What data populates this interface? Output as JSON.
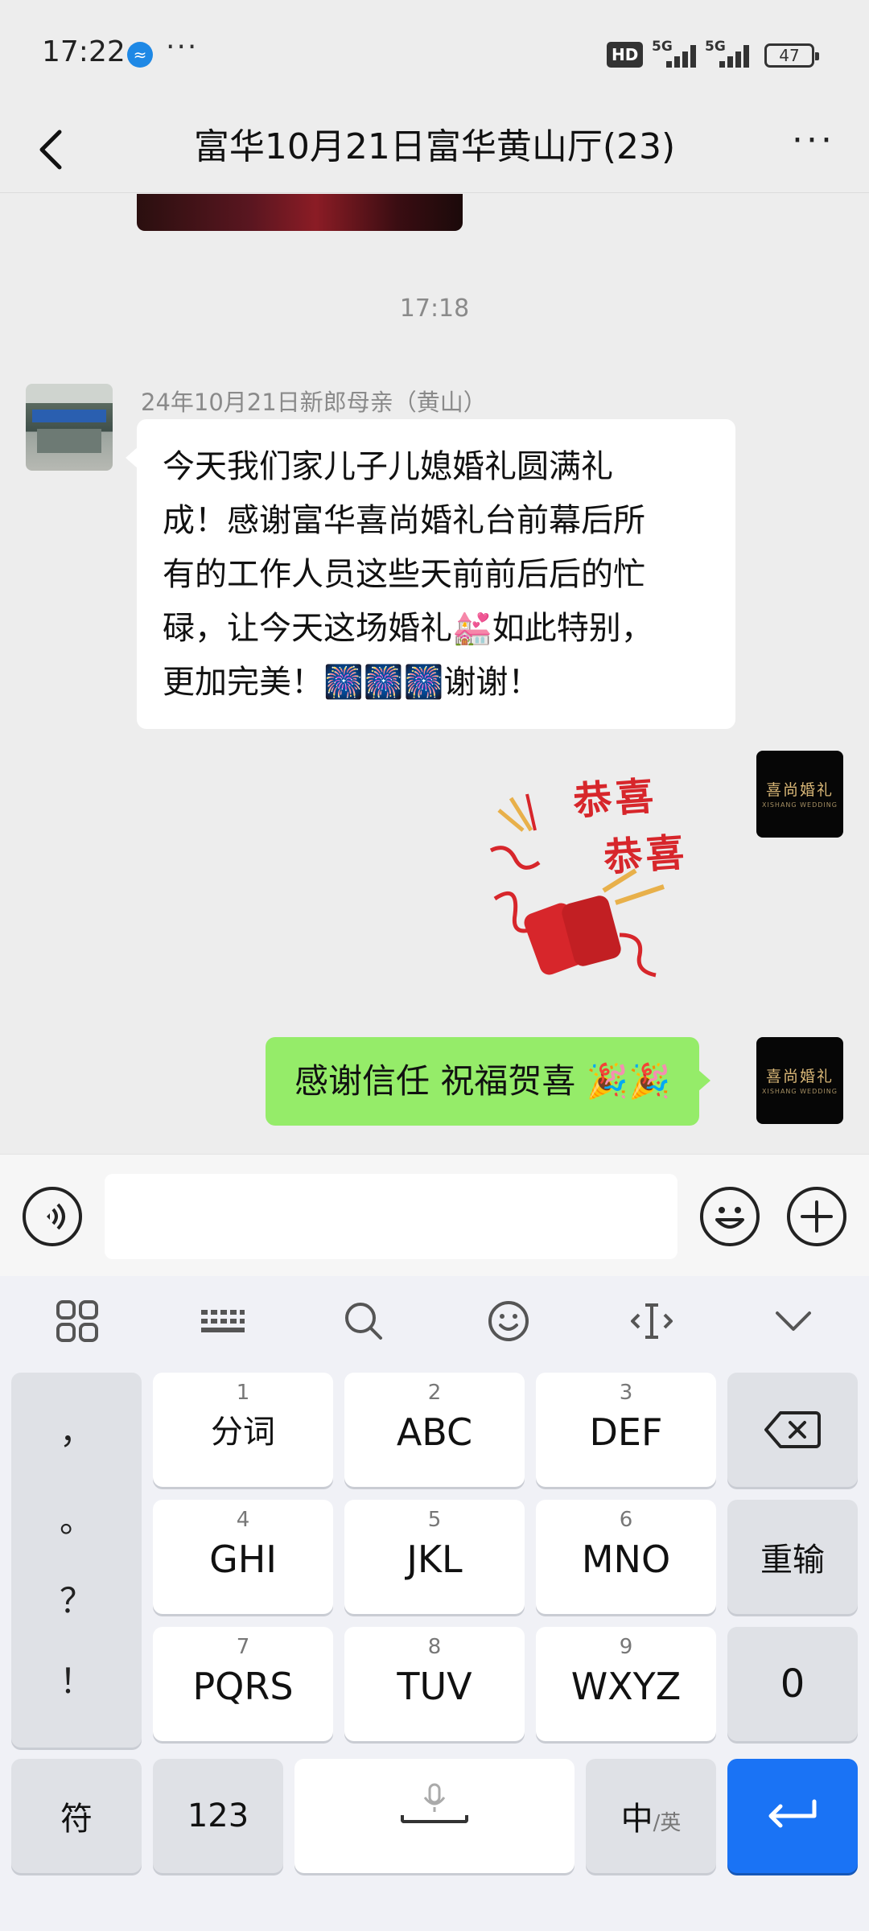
{
  "status_bar": {
    "time": "17:22",
    "network1": "5G",
    "network2": "5G",
    "hd": "HD",
    "battery": "47",
    "app_notification_icon": "messenger-icon"
  },
  "header": {
    "title": "富华10月21日富华黄山厅(23)"
  },
  "chat": {
    "timestamp": "17:18",
    "message1": {
      "sender": "24年10月21日新郎母亲（黄山）",
      "lines": [
        "今天我们家儿子儿媳婚礼圆满礼",
        "成！感谢富华喜尚婚礼台前幕后所",
        "有的工作人员这些天前前后后的忙",
        "碌，让今天这场婚礼💒如此特别，",
        "更加完美！🎆🎆🎆谢谢！"
      ]
    },
    "sticker": {
      "line1": "恭喜",
      "line2": "恭喜"
    },
    "message2": {
      "text": "感谢信任 祝福贺喜 🎉🎉"
    },
    "my_avatar": {
      "brand": "喜尚婚礼",
      "brand_en": "XISHANG WEDDING"
    }
  },
  "input_bar": {
    "placeholder": ""
  },
  "keyboard": {
    "punct": [
      "，",
      "。",
      "？",
      "！"
    ],
    "keys": [
      {
        "num": "1",
        "label": "分词"
      },
      {
        "num": "2",
        "label": "ABC"
      },
      {
        "num": "3",
        "label": "DEF"
      },
      {
        "num": "4",
        "label": "GHI"
      },
      {
        "num": "5",
        "label": "JKL"
      },
      {
        "num": "6",
        "label": "MNO"
      },
      {
        "num": "7",
        "label": "PQRS"
      },
      {
        "num": "8",
        "label": "TUV"
      },
      {
        "num": "9",
        "label": "WXYZ"
      }
    ],
    "retype": "重输",
    "zero": "0",
    "symbols": "符",
    "numbers": "123",
    "lang_main": "中",
    "lang_alt": "/英"
  }
}
